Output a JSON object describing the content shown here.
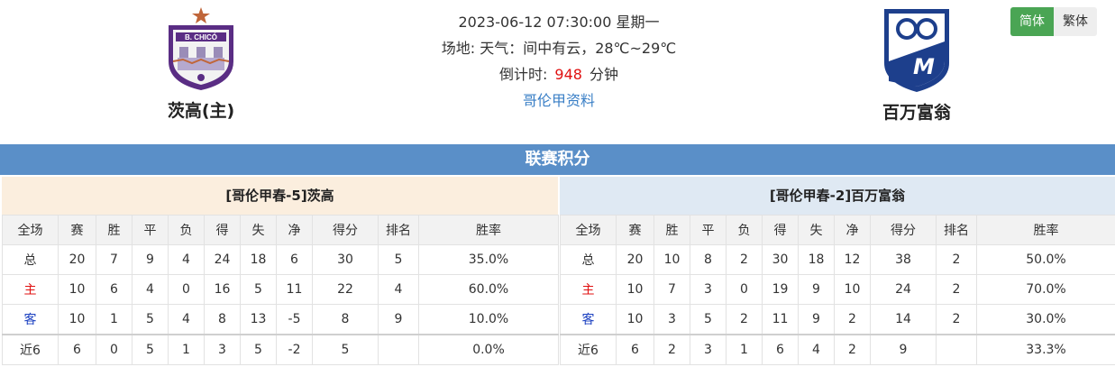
{
  "header": {
    "datetime": "2023-06-12 07:30:00 星期一",
    "venue_weather": "场地:   天气：间中有云，28℃~29℃",
    "countdown_label": "倒计时:",
    "countdown_value": "948",
    "countdown_unit": "分钟",
    "league_link": "哥伦甲资料"
  },
  "home_team": {
    "name": "茨高(主)",
    "logo_text": "B. CHICÓ"
  },
  "away_team": {
    "name": "百万富翁"
  },
  "lang": {
    "simplified": "简体",
    "traditional": "繁体"
  },
  "standings": {
    "title": "联赛积分",
    "columns": [
      "全场",
      "赛",
      "胜",
      "平",
      "负",
      "得",
      "失",
      "净",
      "得分",
      "排名",
      "胜率"
    ],
    "home": {
      "title": "[哥伦甲春-5]茨高",
      "rows": [
        [
          "总",
          "20",
          "7",
          "9",
          "4",
          "24",
          "18",
          "6",
          "30",
          "5",
          "35.0%"
        ],
        [
          "主",
          "10",
          "6",
          "4",
          "0",
          "16",
          "5",
          "11",
          "22",
          "4",
          "60.0%"
        ],
        [
          "客",
          "10",
          "1",
          "5",
          "4",
          "8",
          "13",
          "-5",
          "8",
          "9",
          "10.0%"
        ],
        [
          "近6",
          "6",
          "0",
          "5",
          "1",
          "3",
          "5",
          "-2",
          "5",
          "",
          "0.0%"
        ]
      ]
    },
    "away": {
      "title": "[哥伦甲春-2]百万富翁",
      "rows": [
        [
          "总",
          "20",
          "10",
          "8",
          "2",
          "30",
          "18",
          "12",
          "38",
          "2",
          "50.0%"
        ],
        [
          "主",
          "10",
          "7",
          "3",
          "0",
          "19",
          "9",
          "10",
          "24",
          "2",
          "70.0%"
        ],
        [
          "客",
          "10",
          "3",
          "5",
          "2",
          "11",
          "9",
          "2",
          "14",
          "2",
          "30.0%"
        ],
        [
          "近6",
          "6",
          "2",
          "3",
          "1",
          "6",
          "4",
          "2",
          "9",
          "",
          "33.3%"
        ]
      ]
    }
  }
}
